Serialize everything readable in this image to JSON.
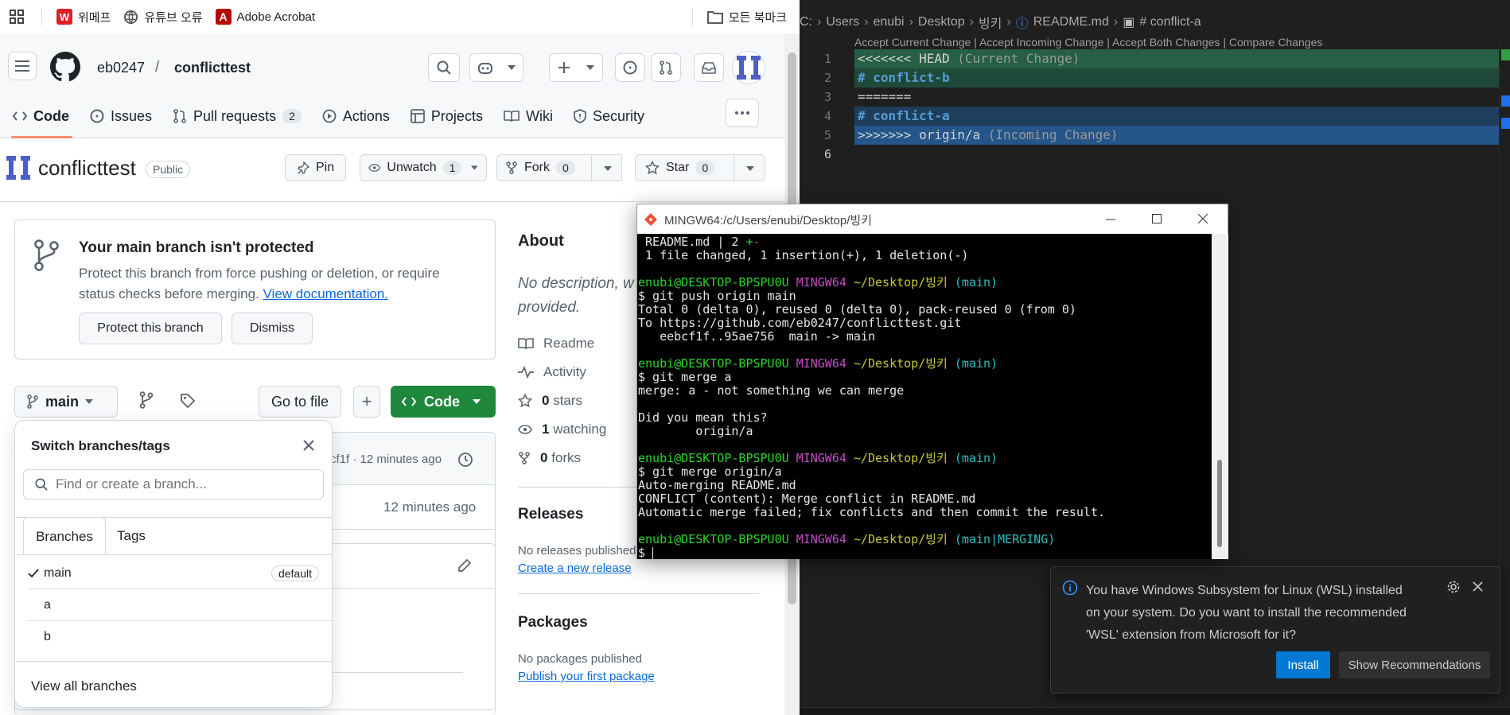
{
  "browser": {
    "bookmarks": [
      {
        "label": "위메프",
        "icon": "wemakeprice-icon"
      },
      {
        "label": "유튜브 오류",
        "icon": "globe-icon"
      },
      {
        "label": "Adobe Acrobat",
        "icon": "acrobat-icon"
      }
    ],
    "all_bookmarks": "모든 북마크"
  },
  "github": {
    "owner": "eb0247",
    "separator": "/",
    "repo": "conflicttest",
    "tabs": [
      {
        "label": "Code"
      },
      {
        "label": "Issues"
      },
      {
        "label": "Pull requests",
        "count": "2"
      },
      {
        "label": "Actions"
      },
      {
        "label": "Projects"
      },
      {
        "label": "Wiki"
      },
      {
        "label": "Security"
      }
    ],
    "visibility": "Public",
    "repo_actions": {
      "pin": "Pin",
      "unwatch": "Unwatch",
      "unwatch_count": "1",
      "fork": "Fork",
      "fork_count": "0",
      "star": "Star",
      "star_count": "0"
    },
    "protection_banner": {
      "title": "Your main branch isn't protected",
      "body": "Protect this branch from force pushing or deletion, or require status checks before merging.",
      "link": "View documentation.",
      "protect_button": "Protect this branch",
      "dismiss_button": "Dismiss"
    },
    "branch_button": "main",
    "go_to_file": "Go to file",
    "plus_label": "+",
    "code_button": "Code",
    "commit_meta": "cf1f · 12 minutes ago",
    "file_time": "12 minutes ago",
    "about": {
      "title": "About",
      "description": "No description, w",
      "description_line2": "provided.",
      "items": [
        {
          "label": "Readme",
          "icon": "book-icon",
          "bold": ""
        },
        {
          "label": "Activity",
          "icon": "pulse-icon",
          "bold": ""
        },
        {
          "label": "stars",
          "icon": "star-icon",
          "bold": "0"
        },
        {
          "label": "watching",
          "icon": "eye-icon",
          "bold": "1"
        },
        {
          "label": "forks",
          "icon": "fork-icon",
          "bold": "0"
        }
      ]
    },
    "releases": {
      "title": "Releases",
      "text": "No releases published",
      "link": "Create a new release"
    },
    "packages": {
      "title": "Packages",
      "text": "No packages published",
      "link": "Publish your first package"
    },
    "branch_dropdown": {
      "title": "Switch branches/tags",
      "placeholder": "Find or create a branch...",
      "tabs": [
        "Branches",
        "Tags"
      ],
      "branches": [
        {
          "name": "main",
          "badge": "default",
          "checked": true
        },
        {
          "name": "a",
          "badge": "",
          "checked": false
        },
        {
          "name": "b",
          "badge": "",
          "checked": false
        }
      ],
      "view_all": "View all branches"
    }
  },
  "vscode": {
    "breadcrumb": [
      "C:",
      "Users",
      "enubi",
      "Desktop",
      "빙키",
      "README.md",
      "# conflict-a"
    ],
    "codelens": "Accept Current Change | Accept Incoming Change | Accept Both Changes | Compare Changes",
    "lines": [
      {
        "n": "1",
        "text": "<<<<<<< HEAD",
        "hint": " (Current Change)",
        "kind": "current-header"
      },
      {
        "n": "2",
        "text": "# conflict-b",
        "hint": "",
        "kind": "current"
      },
      {
        "n": "3",
        "text": "=======",
        "hint": "",
        "kind": "plain"
      },
      {
        "n": "4",
        "text": "# conflict-a",
        "hint": "",
        "kind": "incoming"
      },
      {
        "n": "5",
        "text": ">>>>>>> origin/a",
        "hint": " (Incoming Change)",
        "kind": "incoming-header"
      },
      {
        "n": "6",
        "text": "",
        "hint": "",
        "kind": "plain"
      }
    ],
    "notification": {
      "message": "You have Windows Subsystem for Linux (WSL) installed on your system. Do you want to install the recommended 'WSL' extension from Microsoft for it?",
      "install": "Install",
      "show_recommendations": "Show Recommendations"
    }
  },
  "terminal": {
    "title": "MINGW64:/c/Users/enubi/Desktop/빙키",
    "lines": [
      [
        {
          "t": " README.md | 2 "
        },
        {
          "t": "+",
          "c": "g"
        },
        {
          "t": "-",
          "c": "r"
        }
      ],
      [
        {
          "t": " 1 file changed, 1 insertion(+), 1 deletion(-)"
        }
      ],
      [
        {
          "t": ""
        }
      ],
      [
        {
          "t": "enubi@DESKTOP-BPSPU0U ",
          "c": "g"
        },
        {
          "t": "MINGW64 ",
          "c": "m"
        },
        {
          "t": "~/Desktop/빙키",
          "c": "y"
        },
        {
          "t": " (main)",
          "c": "c"
        }
      ],
      [
        {
          "t": "$ git push origin main"
        }
      ],
      [
        {
          "t": "Total 0 (delta 0), reused 0 (delta 0), pack-reused 0 (from 0)"
        }
      ],
      [
        {
          "t": "To https://github.com/eb0247/conflicttest.git"
        }
      ],
      [
        {
          "t": "   eebcf1f..95ae756  main -> main"
        }
      ],
      [
        {
          "t": ""
        }
      ],
      [
        {
          "t": "enubi@DESKTOP-BPSPU0U ",
          "c": "g"
        },
        {
          "t": "MINGW64 ",
          "c": "m"
        },
        {
          "t": "~/Desktop/빙키",
          "c": "y"
        },
        {
          "t": " (main)",
          "c": "c"
        }
      ],
      [
        {
          "t": "$ git merge a"
        }
      ],
      [
        {
          "t": "merge: a - not something we can merge"
        }
      ],
      [
        {
          "t": ""
        }
      ],
      [
        {
          "t": "Did you mean this?"
        }
      ],
      [
        {
          "t": "        origin/a"
        }
      ],
      [
        {
          "t": ""
        }
      ],
      [
        {
          "t": "enubi@DESKTOP-BPSPU0U ",
          "c": "g"
        },
        {
          "t": "MINGW64 ",
          "c": "m"
        },
        {
          "t": "~/Desktop/빙키",
          "c": "y"
        },
        {
          "t": " (main)",
          "c": "c"
        }
      ],
      [
        {
          "t": "$ git merge origin/a"
        }
      ],
      [
        {
          "t": "Auto-merging README.md"
        }
      ],
      [
        {
          "t": "CONFLICT (content): Merge conflict in README.md"
        }
      ],
      [
        {
          "t": "Automatic merge failed; fix conflicts and then commit the result."
        }
      ],
      [
        {
          "t": ""
        }
      ],
      [
        {
          "t": "enubi@DESKTOP-BPSPU0U ",
          "c": "g"
        },
        {
          "t": "MINGW64 ",
          "c": "m"
        },
        {
          "t": "~/Desktop/빙키",
          "c": "y"
        },
        {
          "t": " (main|MERGING)",
          "c": "c"
        }
      ],
      [
        {
          "t": "$ "
        }
      ]
    ]
  }
}
